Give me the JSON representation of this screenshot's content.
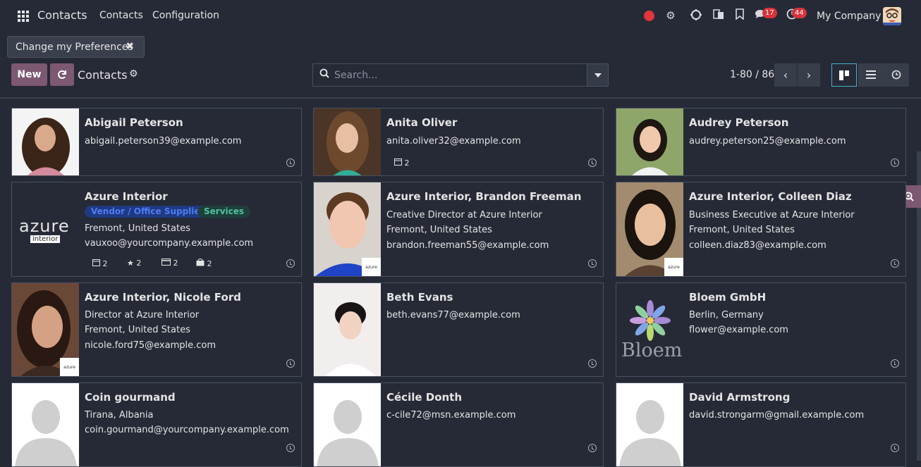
{
  "topbar": {
    "brand": "Contacts",
    "menu": [
      "Contacts",
      "Configuration"
    ],
    "messages_badge": "17",
    "activities_badge": "44",
    "company": "My Company"
  },
  "filter_chip": {
    "label": "Change my Preferences"
  },
  "control": {
    "new_label": "New",
    "breadcrumb": "Contacts",
    "search_placeholder": "Search...",
    "pager": "1-80 / 86"
  },
  "cards": [
    {
      "name": "Abigail Peterson",
      "lines": [
        "abigail.peterson39@example.com"
      ]
    },
    {
      "name": "Anita Oliver",
      "lines": [
        "anita.oliver32@example.com"
      ],
      "stats": [
        "2"
      ]
    },
    {
      "name": "Audrey Peterson",
      "lines": [
        "audrey.peterson25@example.com"
      ]
    },
    {
      "name": "Azure Interior",
      "tags": [
        "Vendor / Office Supplies",
        "Services"
      ],
      "lines": [
        "Fremont, United States",
        "vauxoo@yourcompany.example.com"
      ],
      "stats": [
        "2",
        "2",
        "2",
        "2"
      ],
      "logo_text": "azure",
      "logo_sub": "interior"
    },
    {
      "name": "Azure Interior, Brandon Freeman",
      "lines": [
        "Creative Director at Azure Interior",
        "Fremont, United States",
        "brandon.freeman55@example.com"
      ],
      "mini_logo": "azure"
    },
    {
      "name": "Azure Interior, Colleen Diaz",
      "lines": [
        "Business Executive at Azure Interior",
        "Fremont, United States",
        "colleen.diaz83@example.com"
      ],
      "mini_logo": "azure"
    },
    {
      "name": "Azure Interior, Nicole Ford",
      "lines": [
        "Director at Azure Interior",
        "Fremont, United States",
        "nicole.ford75@example.com"
      ],
      "mini_logo": "azure"
    },
    {
      "name": "Beth Evans",
      "lines": [
        "beth.evans77@example.com"
      ]
    },
    {
      "name": "Bloem GmbH",
      "lines": [
        "Berlin, Germany",
        "flower@example.com"
      ],
      "logo_text": "Bloem"
    },
    {
      "name": "Coin gourmand",
      "lines": [
        "Tirana, Albania",
        "coin.gourmand@yourcompany.example.com"
      ]
    },
    {
      "name": "Cécile Donth",
      "lines": [
        "c-cile72@msn.example.com"
      ]
    },
    {
      "name": "David Armstrong",
      "lines": [
        "david.strongarm@gmail.example.com"
      ]
    }
  ],
  "colors": {
    "background": "#262a36",
    "primary": "#7c5871",
    "badge": "#d6333b",
    "tag_vendor_bg": "#1f3a82",
    "tag_vendor_fg": "#4f7cf5",
    "tag_services_bg": "#1f3f3a",
    "tag_services_fg": "#4fc3a1"
  }
}
